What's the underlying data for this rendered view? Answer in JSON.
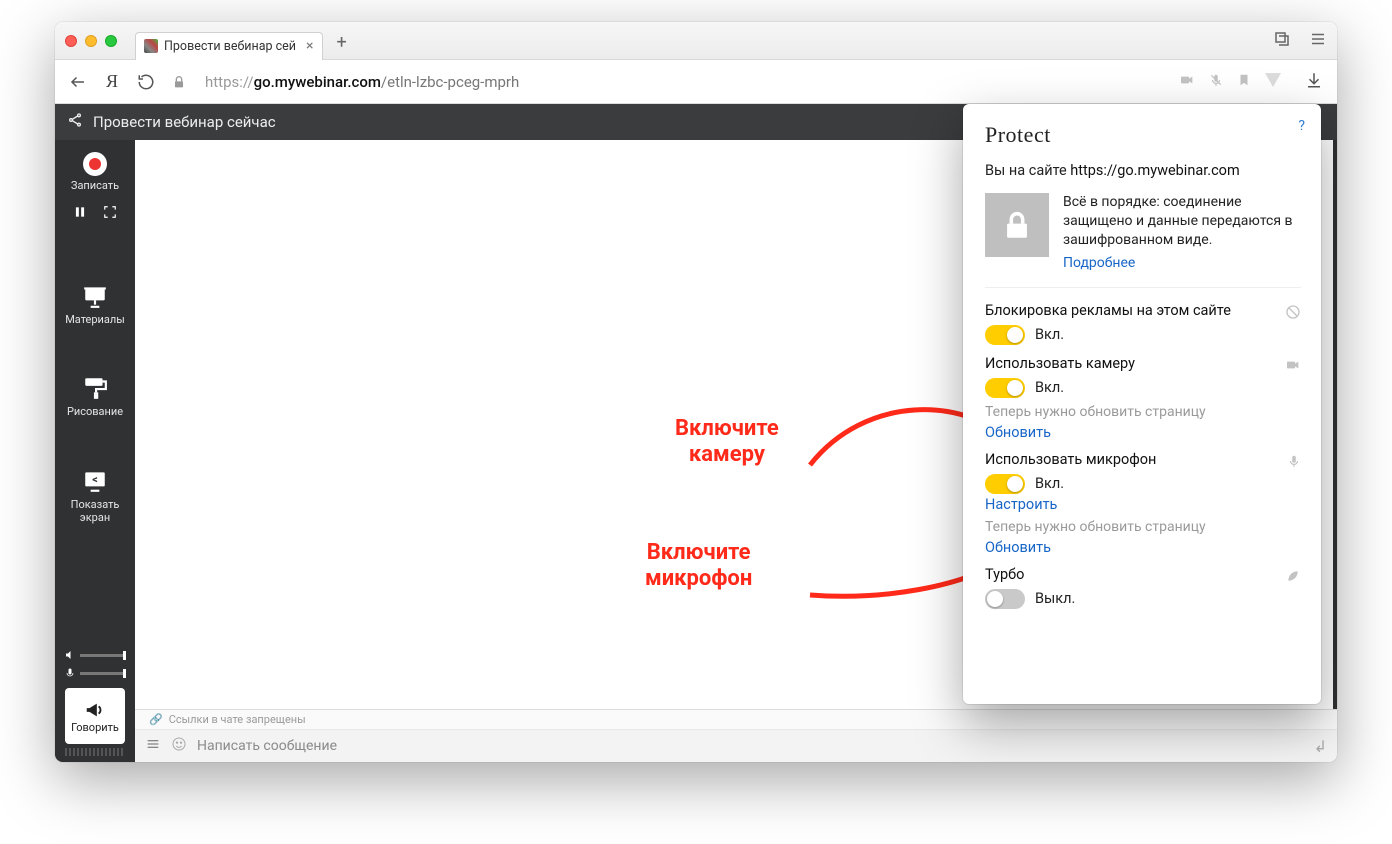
{
  "browser": {
    "tab_title": "Провести вебинар сей",
    "url_secure_prefix": "https://",
    "url_domain": "go.mywebinar.com",
    "url_path": "/etln-lzbc-pceg-mprh"
  },
  "page": {
    "header": "Провести вебинар сейчас",
    "sidebar": {
      "record": "Записать",
      "materials": "Материалы",
      "drawing": "Рисование",
      "show_screen_line1": "Показать",
      "show_screen_line2": "экран",
      "speak": "Говорить"
    },
    "chat": {
      "hint": "Ссылки в чате запрещены",
      "placeholder": "Написать сообщение"
    }
  },
  "annotations": {
    "camera_line1": "Включите",
    "camera_line2": "камеру",
    "mic_line1": "Включите",
    "mic_line2": "микрофон"
  },
  "panel": {
    "title": "Protect",
    "site_prefix": "Вы на сайте ",
    "site_domain": "https://go.mywebinar.com",
    "security_text": "Всё в порядке: соединение защищено и данные передаются в зашифрованном виде.",
    "more": "Подробнее",
    "adblock": {
      "title": "Блокировка рекламы на этом сайте",
      "state": "Вкл."
    },
    "camera": {
      "title": "Использовать камеру",
      "state": "Вкл.",
      "hint": "Теперь нужно обновить страницу",
      "refresh": "Обновить"
    },
    "mic": {
      "title": "Использовать микрофон",
      "state": "Вкл.",
      "configure": "Настроить",
      "hint": "Теперь нужно обновить страницу",
      "refresh": "Обновить"
    },
    "turbo": {
      "title": "Турбо",
      "state": "Выкл."
    }
  }
}
